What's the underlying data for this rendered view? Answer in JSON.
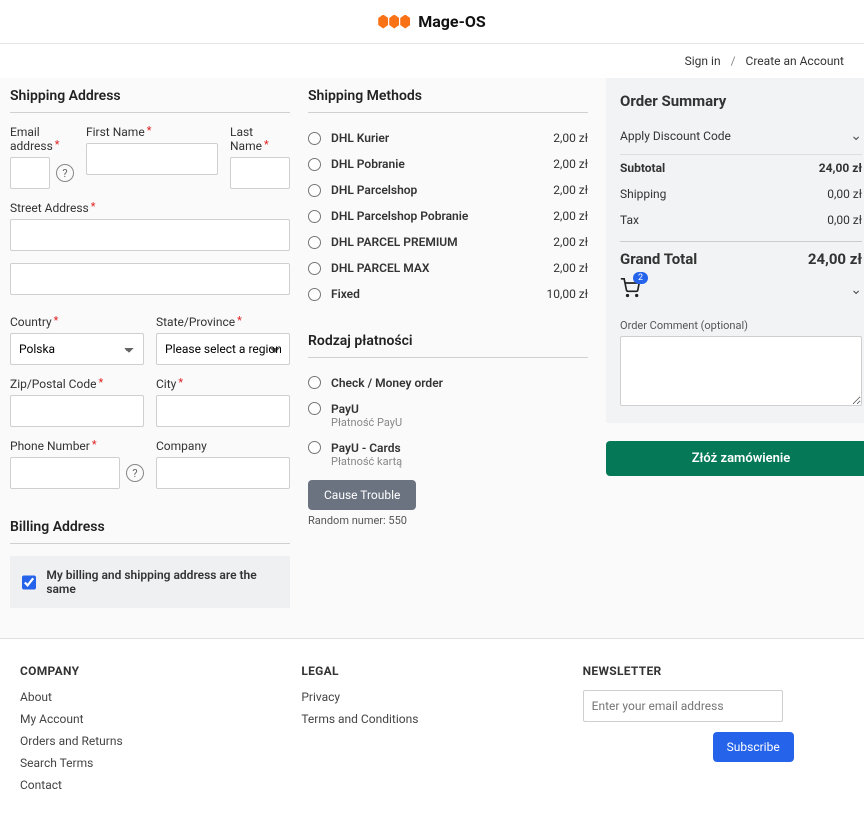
{
  "brand": "Mage-OS",
  "top_links": {
    "sign_in": "Sign in",
    "create_account": "Create an Account"
  },
  "shipping_address": {
    "title": "Shipping Address",
    "email_label": "Email address",
    "first_name_label": "First Name",
    "last_name_label": "Last Name",
    "street_label": "Street Address",
    "country_label": "Country",
    "country_value": "Polska",
    "state_label": "State/Province",
    "state_placeholder": "Please select a region, state or province",
    "zip_label": "Zip/Postal Code",
    "city_label": "City",
    "phone_label": "Phone Number",
    "company_label": "Company"
  },
  "billing": {
    "title": "Billing Address",
    "same_label": "My billing and shipping address are the same"
  },
  "shipping_methods": {
    "title": "Shipping Methods",
    "items": [
      {
        "name": "DHL Kurier",
        "price": "2,00 zł"
      },
      {
        "name": "DHL Pobranie",
        "price": "2,00 zł"
      },
      {
        "name": "DHL Parcelshop",
        "price": "2,00 zł"
      },
      {
        "name": "DHL Parcelshop Pobranie",
        "price": "2,00 zł"
      },
      {
        "name": "DHL PARCEL PREMIUM",
        "price": "2,00 zł"
      },
      {
        "name": "DHL PARCEL MAX",
        "price": "2,00 zł"
      },
      {
        "name": "Fixed",
        "price": "10,00 zł"
      }
    ]
  },
  "payment": {
    "title": "Rodzaj płatności",
    "options": [
      {
        "name": "Check / Money order",
        "sub": ""
      },
      {
        "name": "PayU",
        "sub": "Płatność PayU"
      },
      {
        "name": "PayU - Cards",
        "sub": "Płatność kartą"
      }
    ],
    "trouble_btn": "Cause Trouble",
    "random": "Random numer: 550"
  },
  "summary": {
    "title": "Order Summary",
    "discount_label": "Apply Discount Code",
    "subtotal_lbl": "Subtotal",
    "subtotal_val": "24,00 zł",
    "shipping_lbl": "Shipping",
    "shipping_val": "0,00 zł",
    "tax_lbl": "Tax",
    "tax_val": "0,00 zł",
    "grand_lbl": "Grand Total",
    "grand_val": "24,00 zł",
    "cart_count": "2",
    "comment_label": "Order Comment (optional)",
    "place_order": "Złóż zamówienie"
  },
  "footer": {
    "company_h": "COMPANY",
    "company_links": {
      "a": "About",
      "b": "My Account",
      "c": "Orders and Returns",
      "d": "Search Terms",
      "e": "Contact"
    },
    "legal_h": "LEGAL",
    "legal_links": {
      "a": "Privacy",
      "b": "Terms and Conditions"
    },
    "newsletter_h": "NEWSLETTER",
    "newsletter_placeholder": "Enter your email address",
    "subscribe": "Subscribe"
  }
}
